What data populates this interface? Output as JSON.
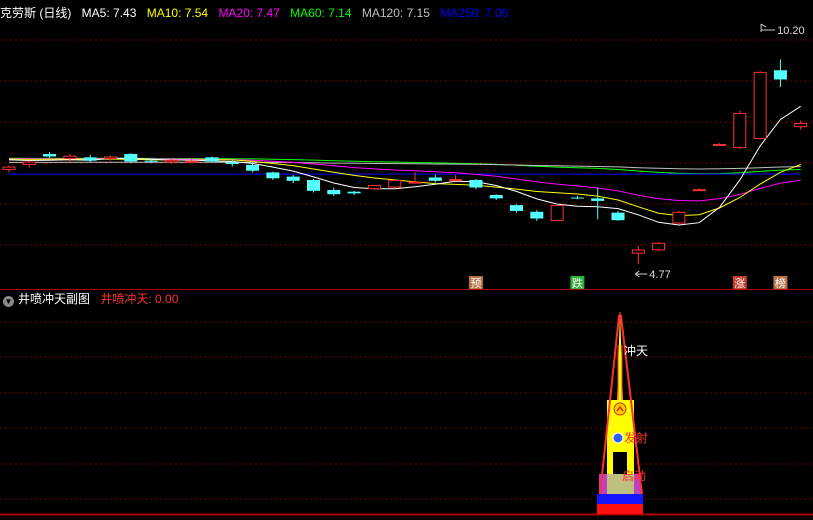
{
  "main_header": {
    "title": "克劳斯 (日线)",
    "ma": [
      {
        "label": "MA5: 7.43",
        "color": "#ffffff"
      },
      {
        "label": "MA10: 7.54",
        "color": "#ffff00"
      },
      {
        "label": "MA20: 7.47",
        "color": "#ff00ff"
      },
      {
        "label": "MA60: 7.14",
        "color": "#00ff00"
      },
      {
        "label": "MA120: 7.15",
        "color": "#c0c0c0"
      },
      {
        "label": "MA250: 7.00",
        "color": "#0000ff"
      }
    ]
  },
  "sub_header": {
    "title": "井喷冲天副图",
    "value_label": "井喷冲天: 0.00",
    "value_color": "#ff3030"
  },
  "colors": {
    "up": "#ff3030",
    "down": "#54ffff",
    "grid": "#7a0000",
    "divider": "#b00000"
  },
  "chart_data": [
    {
      "type": "candlestick",
      "title": "克劳斯 (日线)",
      "ylim": [
        4.2,
        10.6
      ],
      "x": [
        1,
        2,
        3,
        4,
        5,
        6,
        7,
        8,
        9,
        10,
        11,
        12,
        13,
        14,
        15,
        16,
        17,
        18,
        19,
        20,
        21,
        22,
        23,
        24,
        25,
        26,
        27,
        28,
        29,
        30,
        31,
        32,
        33,
        34,
        35,
        36,
        37,
        38,
        39,
        40
      ],
      "ohlc": [
        [
          7.02,
          7.12,
          6.96,
          7.1
        ],
        [
          7.14,
          7.24,
          7.08,
          7.22
        ],
        [
          7.4,
          7.45,
          7.3,
          7.34
        ],
        [
          7.28,
          7.4,
          7.22,
          7.36
        ],
        [
          7.32,
          7.38,
          7.2,
          7.24
        ],
        [
          7.28,
          7.36,
          7.24,
          7.34
        ],
        [
          7.4,
          7.42,
          7.18,
          7.22
        ],
        [
          7.24,
          7.3,
          7.18,
          7.22
        ],
        [
          7.2,
          7.28,
          7.16,
          7.26
        ],
        [
          7.22,
          7.3,
          7.18,
          7.24
        ],
        [
          7.32,
          7.34,
          7.2,
          7.22
        ],
        [
          7.2,
          7.26,
          7.1,
          7.16
        ],
        [
          7.14,
          7.18,
          6.96,
          7.0
        ],
        [
          6.96,
          6.98,
          6.78,
          6.82
        ],
        [
          6.86,
          6.9,
          6.7,
          6.76
        ],
        [
          6.78,
          6.8,
          6.48,
          6.52
        ],
        [
          6.54,
          6.6,
          6.4,
          6.44
        ],
        [
          6.5,
          6.52,
          6.42,
          6.46
        ],
        [
          6.56,
          6.62,
          6.58,
          6.66
        ],
        [
          6.6,
          6.8,
          6.58,
          6.78
        ],
        [
          6.72,
          6.96,
          6.7,
          6.74
        ],
        [
          6.84,
          6.9,
          6.72,
          6.76
        ],
        [
          6.78,
          6.9,
          6.76,
          6.8
        ],
        [
          6.78,
          6.8,
          6.56,
          6.6
        ],
        [
          6.42,
          6.44,
          6.3,
          6.34
        ],
        [
          6.18,
          6.2,
          6.0,
          6.04
        ],
        [
          6.02,
          6.06,
          5.8,
          5.86
        ],
        [
          5.8,
          6.2,
          5.78,
          6.18
        ],
        [
          6.36,
          6.4,
          6.32,
          6.34
        ],
        [
          6.34,
          6.6,
          5.84,
          6.28
        ],
        [
          6.0,
          6.04,
          5.8,
          5.82
        ],
        [
          5.02,
          5.2,
          4.77,
          5.12
        ],
        [
          5.1,
          5.3,
          5.08,
          5.28
        ],
        [
          5.74,
          6.04,
          5.72,
          6.02
        ],
        [
          6.56,
          6.58,
          6.54,
          6.56
        ],
        [
          7.64,
          7.66,
          7.62,
          7.64
        ],
        [
          7.54,
          8.44,
          7.52,
          8.38
        ],
        [
          7.76,
          9.38,
          7.74,
          9.36
        ],
        [
          9.4,
          9.66,
          9.0,
          9.18
        ],
        [
          8.04,
          8.2,
          7.98,
          8.14
        ]
      ],
      "high_label": "10.20",
      "low_label": "4.77",
      "signals": [
        {
          "x": 24,
          "label": "预"
        },
        {
          "x": 29,
          "label": "跌"
        },
        {
          "x": 37,
          "label": "涨"
        },
        {
          "x": 39,
          "label": "榜"
        }
      ]
    },
    {
      "type": "indicator",
      "title": "井喷冲天副图",
      "series": [
        {
          "name": "井喷冲天",
          "values": [
            0.0
          ]
        }
      ],
      "annotations": [
        "冲天",
        "发射",
        "启动"
      ]
    }
  ]
}
